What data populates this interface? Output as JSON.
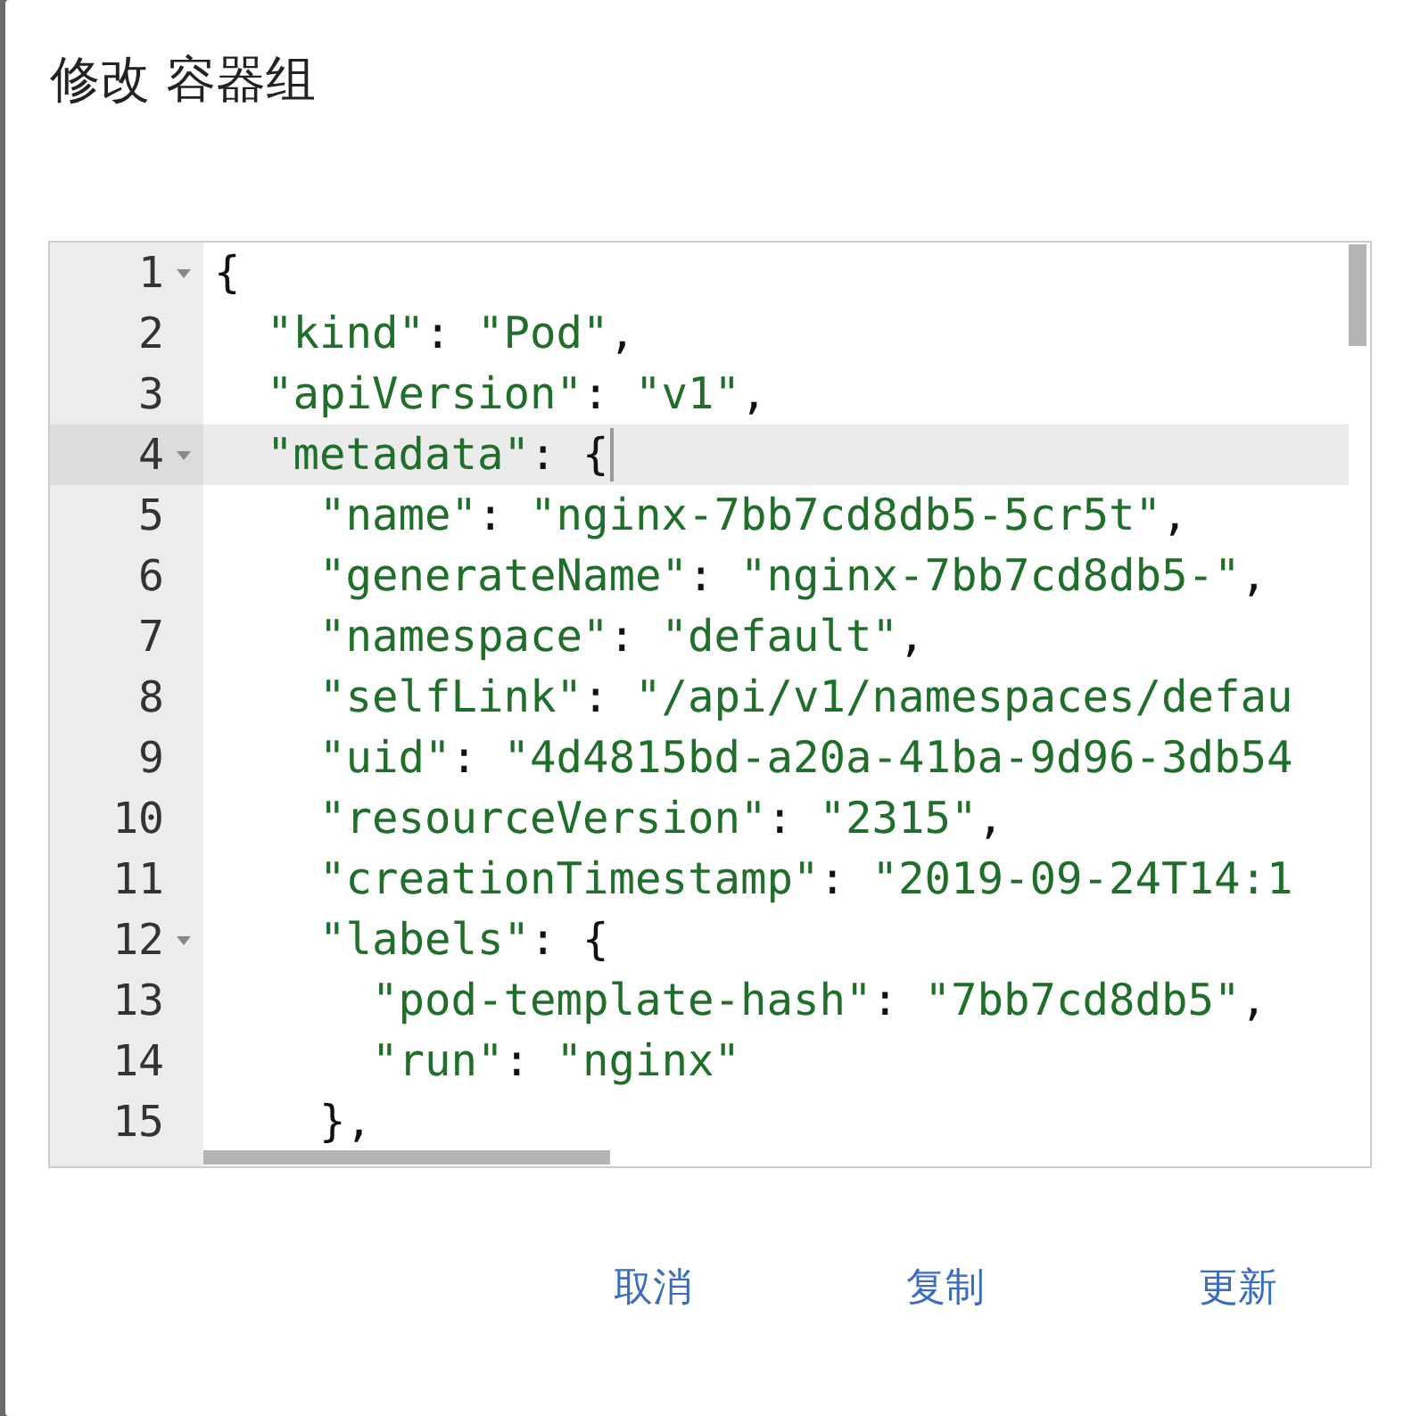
{
  "dialog": {
    "title": "修改 容器组"
  },
  "editor": {
    "lines": [
      {
        "number": "1",
        "text": "{",
        "foldable": true,
        "active": false
      },
      {
        "number": "2",
        "text": "  \"kind\": \"Pod\",",
        "foldable": false,
        "active": false
      },
      {
        "number": "3",
        "text": "  \"apiVersion\": \"v1\",",
        "foldable": false,
        "active": false
      },
      {
        "number": "4",
        "text": "  \"metadata\": {",
        "foldable": true,
        "active": true
      },
      {
        "number": "5",
        "text": "    \"name\": \"nginx-7bb7cd8db5-5cr5t\",",
        "foldable": false,
        "active": false
      },
      {
        "number": "6",
        "text": "    \"generateName\": \"nginx-7bb7cd8db5-\",",
        "foldable": false,
        "active": false
      },
      {
        "number": "7",
        "text": "    \"namespace\": \"default\",",
        "foldable": false,
        "active": false
      },
      {
        "number": "8",
        "text": "    \"selfLink\": \"/api/v1/namespaces/defau",
        "foldable": false,
        "active": false
      },
      {
        "number": "9",
        "text": "    \"uid\": \"4d4815bd-a20a-41ba-9d96-3db54",
        "foldable": false,
        "active": false
      },
      {
        "number": "10",
        "text": "    \"resourceVersion\": \"2315\",",
        "foldable": false,
        "active": false
      },
      {
        "number": "11",
        "text": "    \"creationTimestamp\": \"2019-09-24T14:1",
        "foldable": false,
        "active": false
      },
      {
        "number": "12",
        "text": "    \"labels\": {",
        "foldable": true,
        "active": false
      },
      {
        "number": "13",
        "text": "      \"pod-template-hash\": \"7bb7cd8db5\",",
        "foldable": false,
        "active": false
      },
      {
        "number": "14",
        "text": "      \"run\": \"nginx\"",
        "foldable": false,
        "active": false
      },
      {
        "number": "15",
        "text": "    },",
        "foldable": false,
        "active": false
      }
    ]
  },
  "buttons": [
    {
      "label": "取消"
    },
    {
      "label": "复制"
    },
    {
      "label": "更新"
    }
  ]
}
